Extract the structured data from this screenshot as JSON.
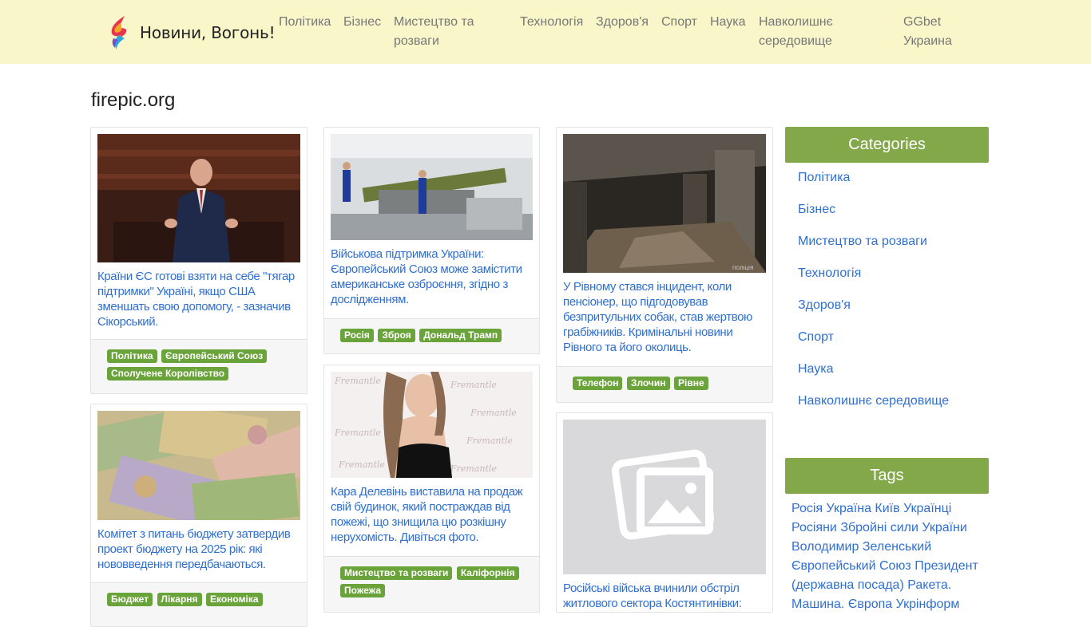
{
  "header": {
    "brand": "Новини, Вогонь!",
    "nav": [
      {
        "label": "Політика"
      },
      {
        "label": "Бізнес"
      },
      {
        "label": "Мистецтво та розваги"
      },
      {
        "label": "Технологія"
      },
      {
        "label": "Здоров'я"
      },
      {
        "label": "Спорт"
      },
      {
        "label": "Наука"
      },
      {
        "label": "Навколишнє середовище"
      },
      {
        "label": "GGbet Украина"
      }
    ]
  },
  "site_title": "firepic.org",
  "articles": [
    {
      "headline": "Країни ЄС готові взяти на себе \"тягар підтримки\" Україні, якщо США зменшать свою допомогу, - зазначив Сікорський.",
      "tags": [
        "Політика",
        "Європейський Союз",
        "Сполучене Королівство"
      ]
    },
    {
      "headline": "Комітет з питань бюджету затвердив проект бюджету на 2025 рік: які нововведення передбачаються.",
      "tags": [
        "Бюджет",
        "Лікарня",
        "Економіка"
      ]
    },
    {
      "headline": "Військова підтримка України: Європейський Союз може замістити американське озброєння, згідно з дослідженням.",
      "tags": [
        "Росія",
        "Зброя",
        "Дональд Трамп"
      ]
    },
    {
      "headline": "Кара Делевінь виставила на продаж свій будинок, який постраждав від пожежі, що знищила цю розкішну нерухомість. Дивіться фото.",
      "tags": [
        "Мистецтво та розваги",
        "Каліфорнія",
        "Пожежа"
      ]
    },
    {
      "headline": "У Рівному стався інцидент, коли пенсіонер, що підгодовував безпритульних собак, став жертвою грабіжників. Кримінальні новини Рівного та його околиць.",
      "tags": [
        "Телефон",
        "Злочин",
        "Рівне"
      ]
    },
    {
      "headline": "Російські війська вчинили обстріл житлового сектора Костянтинівки:",
      "tags": []
    }
  ],
  "sidebar": {
    "categories_title": "Categories",
    "categories": [
      "Політика",
      "Бізнес",
      "Мистецтво та розваги",
      "Технологія",
      "Здоров'я",
      "Спорт",
      "Наука",
      "Навколишнє середовище"
    ],
    "tags_title": "Tags",
    "tags": [
      "Росія",
      "Україна",
      "Київ",
      "Українці",
      "Росіяни",
      "Збройні сили України",
      "Володимир Зеленський",
      "Європейський Союз",
      "Президент (державна посада)",
      "Ракета.",
      "Машина.",
      "Європа",
      "Укрінформ"
    ]
  },
  "colors": {
    "header_bg": "#f9f7c9",
    "link": "#2f6fd0",
    "tag_bg": "#6aa33a",
    "sidebar_head_bg": "#82a84a"
  }
}
